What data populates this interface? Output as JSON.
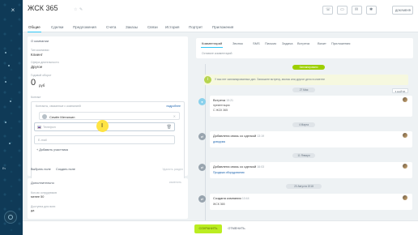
{
  "window": {
    "title": "ЖСК 365",
    "document_button": "ДОКУМЕНТ"
  },
  "tabs": [
    {
      "label": "Общие",
      "active": true
    },
    {
      "label": "Сделки"
    },
    {
      "label": "Предложения"
    },
    {
      "label": "Счета"
    },
    {
      "label": "Заказы"
    },
    {
      "label": "Связи"
    },
    {
      "label": "История"
    },
    {
      "label": "Портрет"
    },
    {
      "label": "Приложения"
    }
  ],
  "about": {
    "heading": "О компании",
    "type_label": "Тип компании",
    "type_value": "Клиент",
    "activity_label": "Сфера деятельности",
    "activity_value": "Другое",
    "revenue_label": "Годовой оборот",
    "revenue_value": "0",
    "revenue_unit": "руб",
    "contact_section_label": "Контакт",
    "contact_hint": "Контакты, связанные с компанией",
    "contact_badge": "подробнее",
    "contact_name": "Семён Металкин",
    "phone_placeholder": "Телефон",
    "email_placeholder": "E-mail",
    "add_participant": "+ Добавить участника",
    "select_field": "Выбрать поле",
    "create_field": "Создать поле",
    "delete_section": "Удалить раздел"
  },
  "additional": {
    "heading": "Дополнительно",
    "edit_label": "изменить",
    "employees_label": "Кол-во сотрудников",
    "employees_value": "менее 50",
    "available_label": "Доступна для всех",
    "available_value": "да"
  },
  "feed": {
    "tabs": [
      "Комментарий",
      "Звонок",
      "SMS",
      "Письмо",
      "Задача",
      "Встреча",
      "Визит",
      "Приложения"
    ],
    "placeholder": "Оставьте комментарий",
    "planned_pill": "Запланировано",
    "planned_text": "У вас нет запланированных дел. Запишите встречу, звонок или другое дело в клиенте",
    "expand_label": "▾ НАЙТИ",
    "date1": "27 Мая",
    "event1_title": "Встреча",
    "event1_time": "15:21",
    "event1_body1": "презентация",
    "event1_body2": "С ЖСК 365",
    "date2": "4 Марта",
    "event2_title": "Добавлена связь со сделкой",
    "event2_time": "13:19",
    "event2_link": "доводчик",
    "date3": "11 Января",
    "event3_title": "Добавлена связь со сделкой",
    "event3_time": "16:03",
    "event3_link": "Продажа оборудования",
    "date4": "20 Августа 2018",
    "event4_title": "Создана компания",
    "event4_time": "10:44",
    "event4_body": "ЖСК 365"
  },
  "footer": {
    "save": "СОХРАНИТЬ",
    "cancel": "ОТМЕНИТЬ"
  },
  "sidebar": {
    "label": "Ev"
  },
  "colors": {
    "sidebar": "#0f3a57",
    "accent": "#2fc6f6",
    "save": "#bbed21",
    "planned": "#9dcf00",
    "cursor": "#ffe33b"
  }
}
